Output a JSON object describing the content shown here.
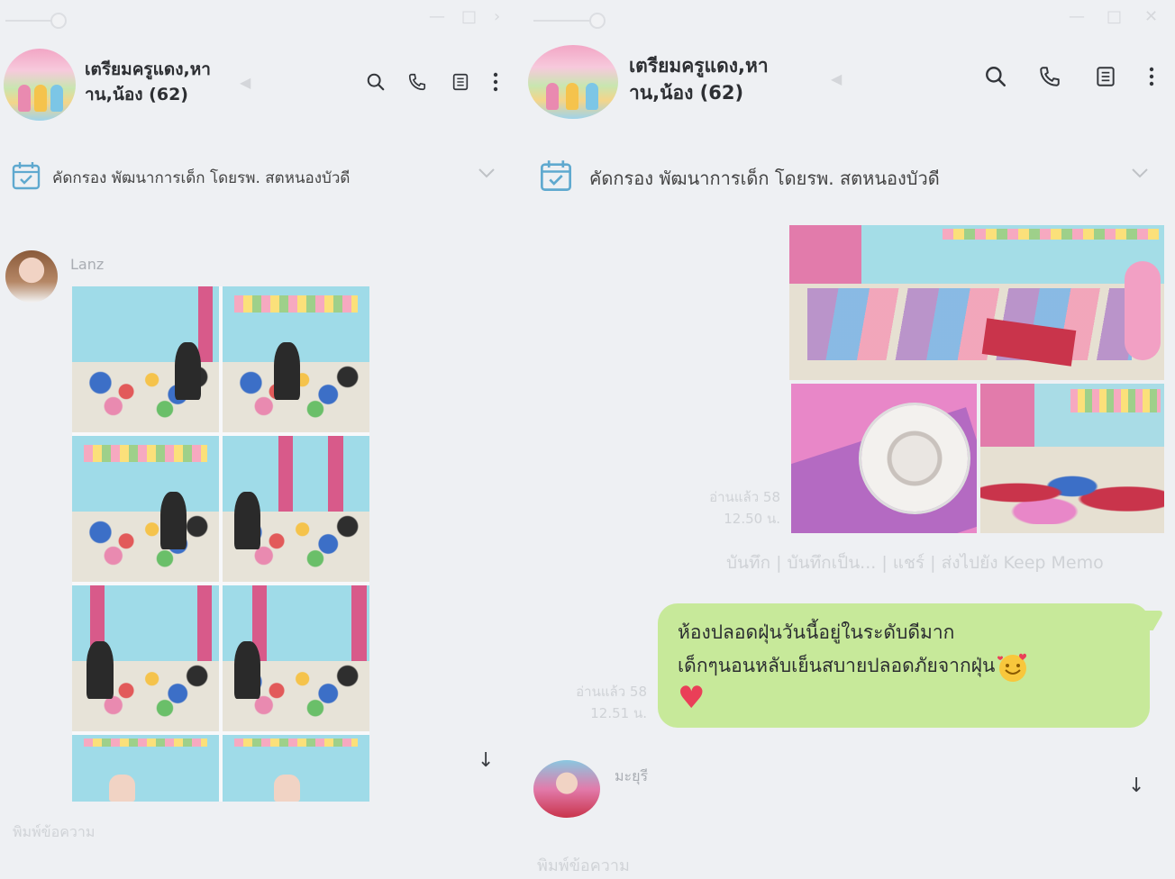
{
  "left": {
    "group_name_line1": "เตรียมครูแดง,หา",
    "group_name_line2": "าน,น้อง (62)",
    "announcement": "คัดกรอง พัฒนาการเด็ก โดยรพ. สตหนองบัวดี",
    "sender": "Lanz",
    "input_placeholder": "พิมพ์ข้อความ",
    "scroll_down_icon": "arrow-down-icon"
  },
  "right": {
    "group_name_line1": "เตรียมครูแดง,หา",
    "group_name_line2": "าน,น้อง (62)",
    "announcement": "คัดกรอง พัฒนาการเด็ก โดยรพ. สตหนองบัวดี",
    "photo_read": "อ่านแล้ว 58",
    "photo_time": "12.50 น.",
    "photo_actions": "บันทึก | บันทึกเป็น... | แชร์ | ส่งไปยัง Keep Memo",
    "message_line1": "ห้องปลอดฝุ่นวันนี้อยู่ในระดับดีมาก",
    "message_line2": "เด็กๆนอนหลับเย็นสบายปลอดภัยจากฝุ่น",
    "message_read": "อ่านแล้ว 58",
    "message_time": "12.51 น.",
    "sender2": "มะยุรี",
    "input_placeholder": "พิมพ์ข้อความ"
  },
  "colors": {
    "background": "#eef0f3",
    "bubble": "#c7e99a",
    "announcement_icon": "#5fa9cf",
    "heart": "#ea3f58"
  },
  "icons": [
    "search-icon",
    "phone-icon",
    "notes-icon",
    "more-icon",
    "calendar-icon",
    "chevron-down-icon",
    "arrow-down-icon",
    "speaker-muted-icon"
  ]
}
